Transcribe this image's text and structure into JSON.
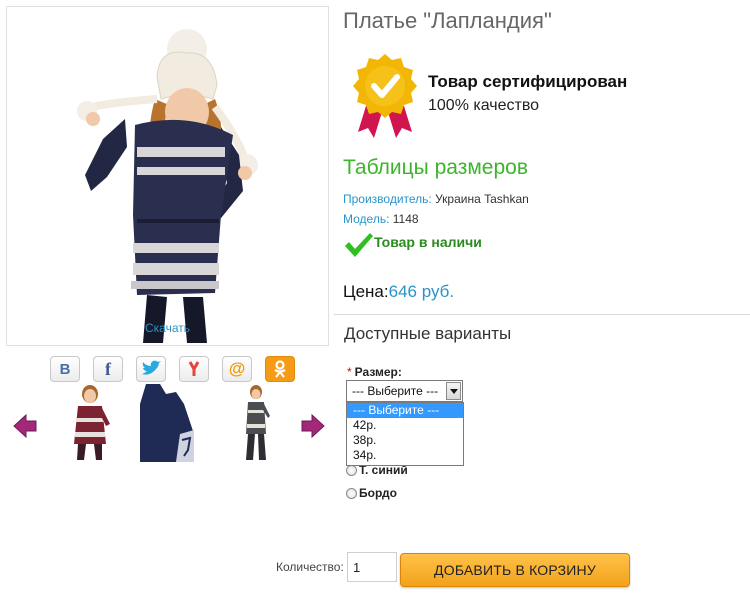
{
  "product": {
    "title": "Платье \"Лапландия\"",
    "download_link": "Скачать"
  },
  "social": {
    "items": [
      {
        "label": "В",
        "color": "#4a6ea8"
      },
      {
        "label": "f",
        "color": "#3b5998"
      },
      {
        "label": "",
        "color": "#29a9e1"
      },
      {
        "label": "",
        "color": "#e5463a"
      },
      {
        "label": "@",
        "color": "#f39a00"
      },
      {
        "label": "",
        "color": "#f59b16"
      }
    ]
  },
  "certificate": {
    "title": "Товар сертифицирован",
    "subtitle": "100% качество"
  },
  "size_tables_link": "Таблицы размеров",
  "meta": {
    "manufacturer_label": "Производитель:",
    "manufacturer_value": " Украина Tashkan",
    "model_label": "Модель:",
    "model_value": " 1148"
  },
  "stock_status": "Товар в наличи",
  "price": {
    "label": "Цена:",
    "value": "646 руб."
  },
  "variants": {
    "title": "Доступные варианты",
    "size_required_mark": "*",
    "size_label": "Размер:",
    "size_selected": "--- Выберите ---",
    "size_options": [
      "--- Выберите ---",
      "42р.",
      "38р.",
      "34р."
    ],
    "color_options": [
      "Т. синий",
      "Бордо"
    ]
  },
  "quantity": {
    "label": "Количество:",
    "value": "1"
  },
  "add_to_cart": "ДОБАВИТЬ В КОРЗИНУ",
  "colors": {
    "accent_blue": "#2a93c9",
    "green": "#3cb52b",
    "cart_button": "#f3a21a"
  }
}
